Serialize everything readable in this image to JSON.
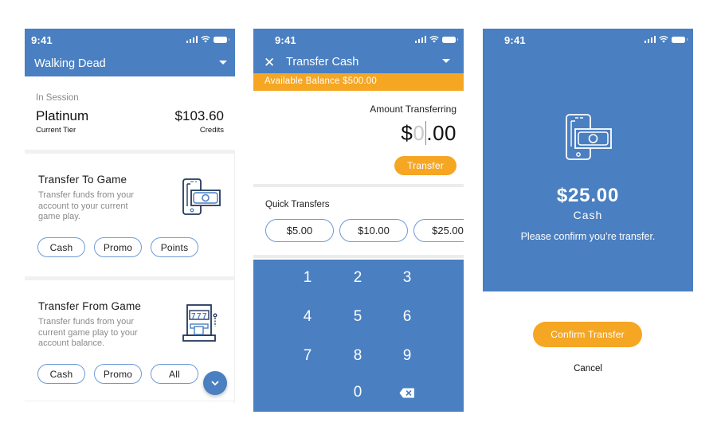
{
  "status_bar": {
    "time": "9:41"
  },
  "colors": {
    "primary_blue": "#4a7fc1",
    "accent_orange": "#f5a623",
    "pill_border": "#6e9bd6",
    "muted_text": "#8a8a8a"
  },
  "screen1": {
    "header": {
      "title": "Walking Dead",
      "dropdown_icon": "caret-down-icon"
    },
    "session": {
      "label": "In Session",
      "tier_value": "Platinum",
      "tier_label": "Current Tier",
      "credits_value": "$103.60",
      "credits_label": "Credits"
    },
    "transfer_to_game": {
      "title": "Transfer To Game",
      "description": "Transfer funds from your account to your current game play.",
      "icon": "phone-cash-icon",
      "buttons": [
        "Cash",
        "Promo",
        "Points"
      ]
    },
    "transfer_from_game": {
      "title": "Transfer From Game",
      "description": "Transfer funds from your current game play to your account balance.",
      "icon": "slot-machine-icon",
      "buttons": [
        "Cash",
        "Promo",
        "All"
      ]
    },
    "fab_icon": "chevron-down-icon"
  },
  "screen2": {
    "header": {
      "title": "Transfer Cash",
      "close_icon": "close-icon",
      "dropdown_icon": "caret-down-icon"
    },
    "available_balance": "Available Balance $500.00",
    "amount": {
      "label": "Amount Transferring",
      "currency": "$",
      "placeholder_digit": "0",
      "decimals": ".00"
    },
    "transfer_button": "Transfer",
    "quick_transfers": {
      "label": "Quick Transfers",
      "options": [
        "$5.00",
        "$10.00",
        "$25.00"
      ]
    },
    "keypad": {
      "keys": [
        "1",
        "2",
        "3",
        "4",
        "5",
        "6",
        "7",
        "8",
        "9",
        "0"
      ],
      "backspace_icon": "backspace-icon"
    }
  },
  "screen3": {
    "icon": "phone-cash-icon",
    "amount": "$25.00",
    "type": "Cash",
    "message": "Please confirm you’re transfer.",
    "confirm_button": "Confirm Transfer",
    "cancel_button": "Cancel"
  }
}
